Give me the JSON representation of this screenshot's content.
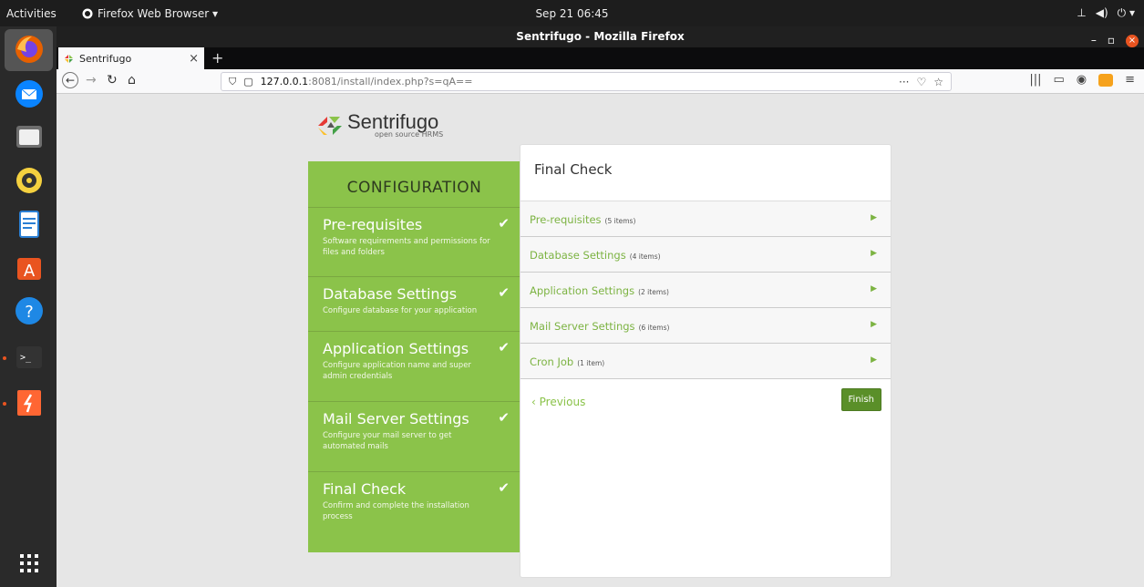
{
  "system": {
    "activities": "Activities",
    "app_menu": "Firefox Web Browser ▾",
    "clock": "Sep 21 06:45",
    "tray": [
      "⊥",
      "◀)",
      "⏻ ▾"
    ]
  },
  "browser": {
    "window_title": "Sentrifugo - Mozilla Firefox",
    "tab_title": "Sentrifugo",
    "tab_close": "×",
    "new_tab": "+",
    "url_host": "127.0.0.1",
    "url_rest": ":8081/install/index.php?s=qA=="
  },
  "page": {
    "logo_name": "Sentrifugo",
    "logo_sub": "open source HRMS",
    "config_title": "CONFIGURATION",
    "steps": [
      {
        "title": "Pre-requisites",
        "desc": "Software requirements and permissions for files and folders"
      },
      {
        "title": "Database Settings",
        "desc": "Configure database for your application"
      },
      {
        "title": "Application Settings",
        "desc": "Configure application name and super admin credentials"
      },
      {
        "title": "Mail Server Settings",
        "desc": "Configure your mail server to get automated mails"
      },
      {
        "title": "Final Check",
        "desc": "Confirm and complete the installation process"
      }
    ],
    "panel_title": "Final Check",
    "sections": [
      {
        "label": "Pre-requisites",
        "count": "(5 items)"
      },
      {
        "label": "Database Settings",
        "count": "(4 items)"
      },
      {
        "label": "Application Settings",
        "count": "(2 items)"
      },
      {
        "label": "Mail Server Settings",
        "count": "(6 items)"
      },
      {
        "label": "Cron Job",
        "count": "(1 item)"
      }
    ],
    "previous_label": "Previous",
    "finish_label": "Finish"
  },
  "colors": {
    "accent": "#8bc34a",
    "finish": "#5a8f29",
    "ubuntu_orange": "#e95420"
  }
}
